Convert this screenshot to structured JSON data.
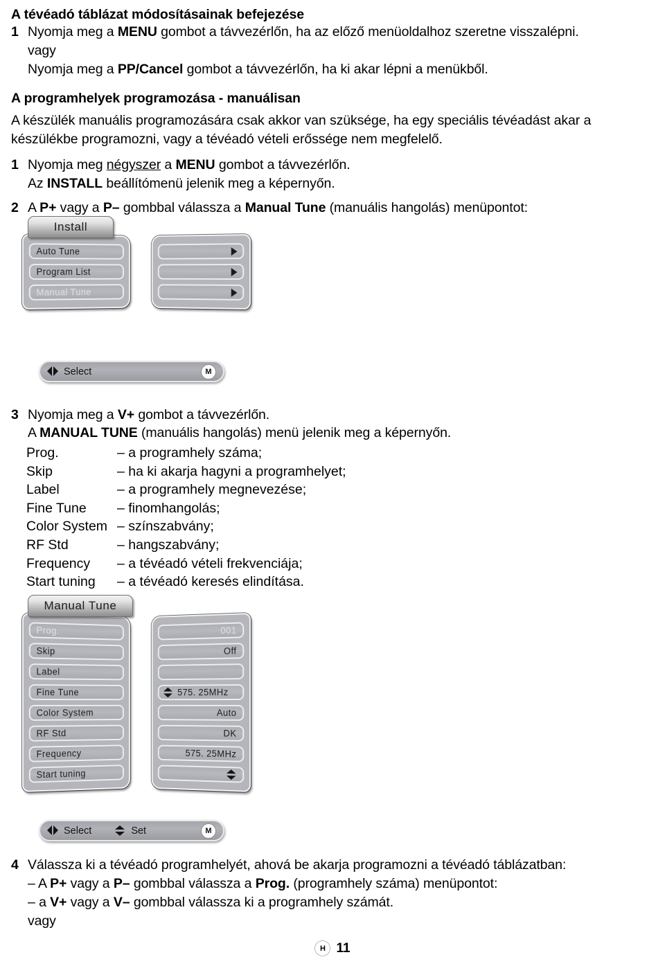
{
  "document": {
    "page_number": "11",
    "footer_mark": "H"
  },
  "section1": {
    "heading": "A tévéadó táblázat módosításainak befejezése",
    "step1_number": "1",
    "step1_line1_a": "Nyomja meg a ",
    "step1_line1_key": "MENU",
    "step1_line1_b": " gombot a távvezérlőn, ha az előző menüoldalhoz szeretne visszalépni.",
    "step1_or": "vagy",
    "step1_line2_a": "Nyomja meg a ",
    "step1_line2_key": "PP/Cancel",
    "step1_line2_b": " gombot a távvezérlőn, ha ki akar lépni a menükből."
  },
  "section2": {
    "heading": "A programhelyek programozása - manuálisan",
    "intro_line1": "A készülék manuális programozására csak akkor van szüksége, ha egy speciális tévéadást akar a",
    "intro_line2": "készülékbe programozni, vagy a tévéadó vételi erőssége nem megfelelő.",
    "step1_number": "1",
    "step1_a": "Nyomja meg ",
    "step1_underline": "négyszer",
    "step1_b": " a ",
    "step1_key": "MENU",
    "step1_c": " gombot a távvezérlőn.",
    "step1_line2_a": "Az ",
    "step1_line2_key": "INSTALL",
    "step1_line2_b": " beállítómenü jelenik meg a képernyőn.",
    "step2_number": "2",
    "step2_a": "A ",
    "step2_key1": "P+",
    "step2_b": " vagy a ",
    "step2_key2": "P–",
    "step2_c": " gombbal válassza a ",
    "step2_key3": "Manual Tune",
    "step2_d": " (manuális hangolás) menüpontot:",
    "step3_number": "3",
    "step3_a": "Nyomja meg a ",
    "step3_key": "V+",
    "step3_b": " gombot a távvezérlőn.",
    "step3_line2_a": "A ",
    "step3_line2_key": "MANUAL TUNE",
    "step3_line2_b": " (manuális hangolás) menü jelenik meg a képernyőn.",
    "step4_number": "4",
    "step4_line1": "Válassza ki a tévéadó programhelyét, ahová be akarja programozni a tévéadó táblázatban:",
    "step4_line2_a": "– A ",
    "step4_line2_key1": "P+",
    "step4_line2_b": " vagy a ",
    "step4_line2_key2": "P–",
    "step4_line2_c": " gombbal válassza a ",
    "step4_line2_key3": "Prog.",
    "step4_line2_d": " (programhely száma) menüpontot:",
    "step4_line3_a": "– a ",
    "step4_line3_key1": "V+",
    "step4_line3_b": " vagy a ",
    "step4_line3_key2": "V–",
    "step4_line3_c": " gombbal válassza ki a programhely számát.",
    "step4_or": "vagy"
  },
  "definition_list": [
    {
      "term": "Prog.",
      "desc": "– a programhely száma;"
    },
    {
      "term": "Skip",
      "desc": "– ha ki akarja hagyni a programhelyet;"
    },
    {
      "term": "Label",
      "desc": "– a programhely megnevezése;"
    },
    {
      "term": "Fine Tune",
      "desc": "– finomhangolás;"
    },
    {
      "term": "Color System",
      "desc": "– színszabvány;"
    },
    {
      "term": "RF Std",
      "desc": "– hangszabvány;"
    },
    {
      "term": "Frequency",
      "desc": "– a tévéadó vételi frekvenciája;"
    },
    {
      "term": "Start tuning",
      "desc": "– a tévéadó keresés elindítása."
    }
  ],
  "osd_install": {
    "title": "Install",
    "items": [
      {
        "label": "Auto Tune",
        "selected": false,
        "arrow": "right-arrow-icon"
      },
      {
        "label": "Program List",
        "selected": false,
        "arrow": "right-arrow-icon"
      },
      {
        "label": "Manual Tune",
        "selected": true,
        "arrow": "right-arrow-icon"
      }
    ],
    "hint_bar": {
      "select_label": "Select",
      "menu_badge": "M"
    }
  },
  "osd_manual_tune": {
    "title": "Manual Tune",
    "rows": [
      {
        "label": "Prog.",
        "value": "001",
        "selected": true,
        "value_icon": ""
      },
      {
        "label": "Skip",
        "value": "Off",
        "selected": false,
        "value_icon": ""
      },
      {
        "label": "Label",
        "value": "--------",
        "selected": false,
        "value_icon": "",
        "dashes": true
      },
      {
        "label": "Fine Tune",
        "value": "575. 25MHz",
        "selected": false,
        "value_icon": "up-down-arrows-icon"
      },
      {
        "label": "Color System",
        "value": "Auto",
        "selected": false,
        "value_icon": ""
      },
      {
        "label": "RF Std",
        "value": "DK",
        "selected": false,
        "value_icon": ""
      },
      {
        "label": "Frequency",
        "value": "575. 25MHz",
        "selected": false,
        "value_icon": ""
      },
      {
        "label": "Start tuning",
        "value": "",
        "selected": false,
        "value_icon": "up-down-arrows-icon-right"
      }
    ],
    "hint_bar": {
      "select_label": "Select",
      "set_label": "Set",
      "menu_badge": "M"
    }
  },
  "colors": {
    "page_background": "#ffffff",
    "text": "#000000",
    "osd_panel": "#b4b6bb",
    "osd_row": "#b0b2b8",
    "osd_row_border": "#ededf0",
    "osd_selected_text": "#dfe1e4"
  }
}
